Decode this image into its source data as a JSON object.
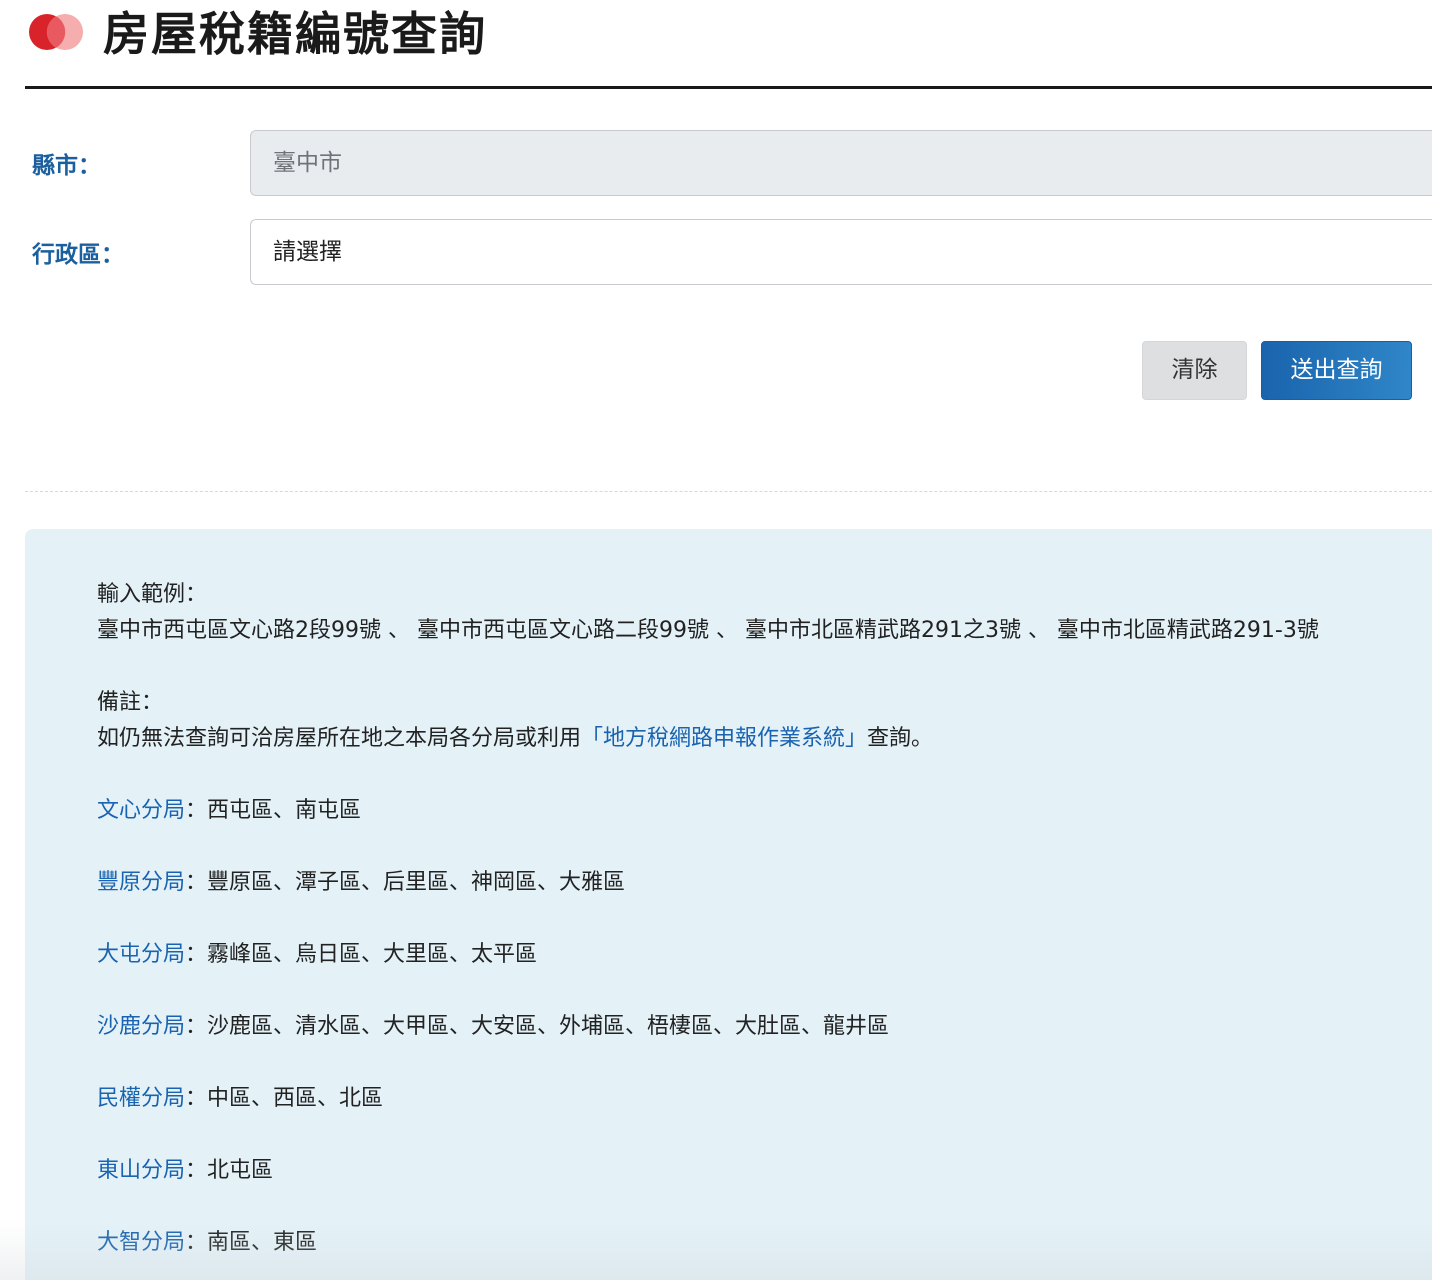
{
  "header": {
    "title": "房屋稅籍編號查詢",
    "logo_colors": [
      "#d8232a",
      "#f4a6a6"
    ]
  },
  "form": {
    "county": {
      "label": "縣市：",
      "value": "臺中市"
    },
    "district": {
      "label": "行政區：",
      "selected": "請選擇"
    },
    "buttons": {
      "clear": "清除",
      "submit": "送出查詢"
    }
  },
  "info": {
    "example_heading": "輸入範例：",
    "example_text": "臺中市西屯區文心路2段99號 、 臺中市西屯區文心路二段99號 、 臺中市北區精武路291之3號 、 臺中市北區精武路291-3號",
    "note_heading": "備註：",
    "note_prefix": "如仍無法查詢可洽房屋所在地之本局各分局或利用",
    "note_link": "「地方稅網路申報作業系統」",
    "note_suffix": "查詢。",
    "branches": [
      {
        "name": "文心分局",
        "districts": "：西屯區、南屯區"
      },
      {
        "name": "豐原分局",
        "districts": "：豐原區、潭子區、后里區、神岡區、大雅區"
      },
      {
        "name": "大屯分局",
        "districts": "：霧峰區、烏日區、大里區、太平區"
      },
      {
        "name": "沙鹿分局",
        "districts": "：沙鹿區、清水區、大甲區、大安區、外埔區、梧棲區、大肚區、龍井區"
      },
      {
        "name": "民權分局",
        "districts": "：中區、西區、北區"
      },
      {
        "name": "東山分局",
        "districts": "：北屯區"
      },
      {
        "name": "大智分局",
        "districts": "：南區、東區"
      }
    ]
  },
  "colors": {
    "label_blue": "#1b5f9e",
    "link_blue": "#1a63b0",
    "panel_bg": "#e4f2f8",
    "submit_bg": "#1a64ad"
  }
}
